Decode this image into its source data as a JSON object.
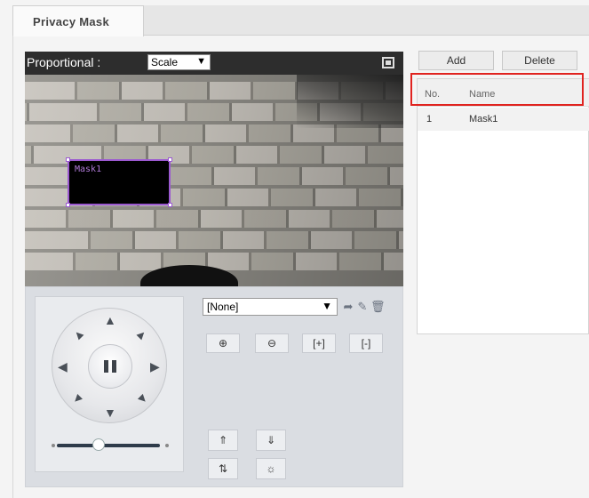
{
  "tab": {
    "label": "Privacy Mask"
  },
  "video": {
    "proportional_label": "Proportional :",
    "scale_value": "Scale",
    "mask_overlay_label": "Mask1"
  },
  "ptz": {
    "preset_value": "[None]"
  },
  "actions": {
    "add_label": "Add",
    "delete_label": "Delete"
  },
  "mask_list": {
    "columns": [
      "No.",
      "Name"
    ],
    "rows": [
      {
        "no": "1",
        "name": "Mask1"
      }
    ]
  },
  "colors": {
    "highlight": "#e0231f",
    "mask_border": "#9b59d0"
  }
}
